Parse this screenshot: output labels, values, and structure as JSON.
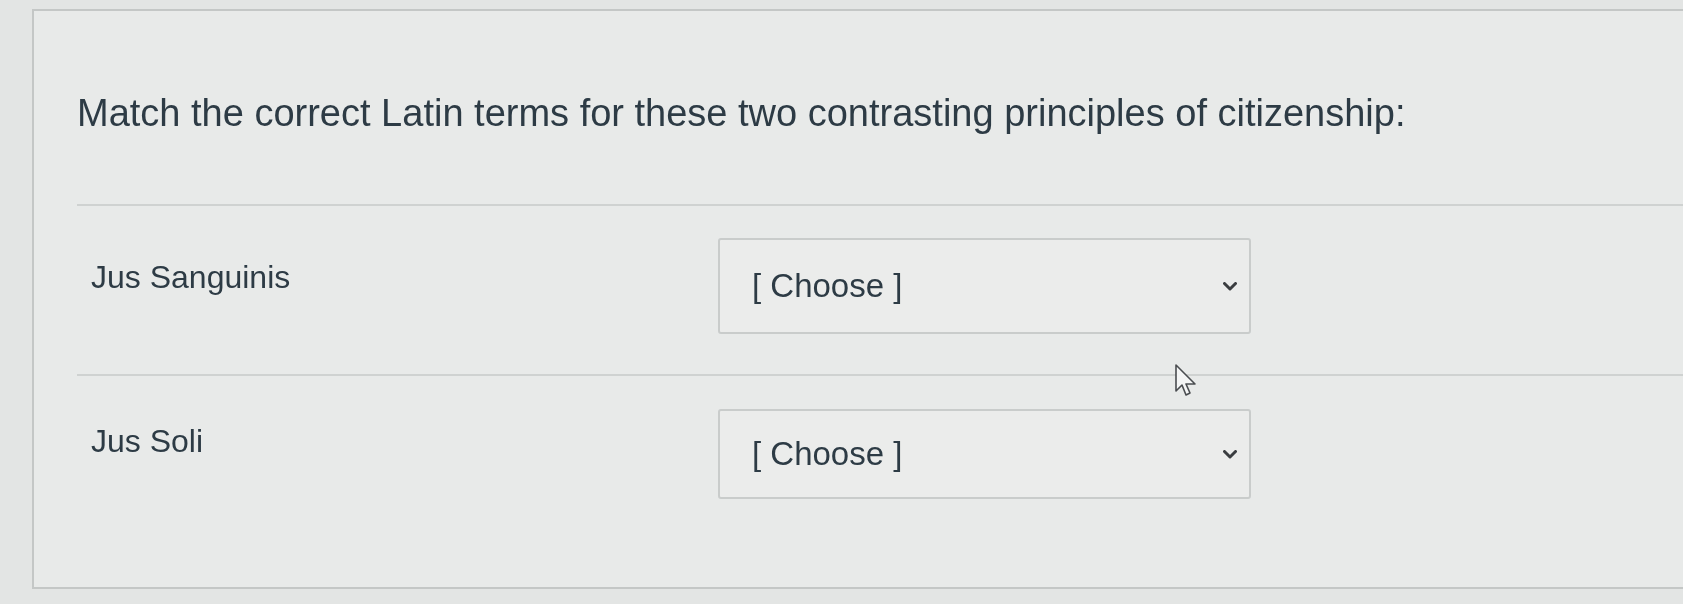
{
  "question": {
    "text": "Match the correct Latin terms for these two contrasting principles of citizenship:"
  },
  "matches": [
    {
      "term": "Jus Sanguinis",
      "select": {
        "value": "[ Choose ]"
      }
    },
    {
      "term": "Jus Soli",
      "select": {
        "value": "[ Choose ]"
      }
    }
  ]
}
